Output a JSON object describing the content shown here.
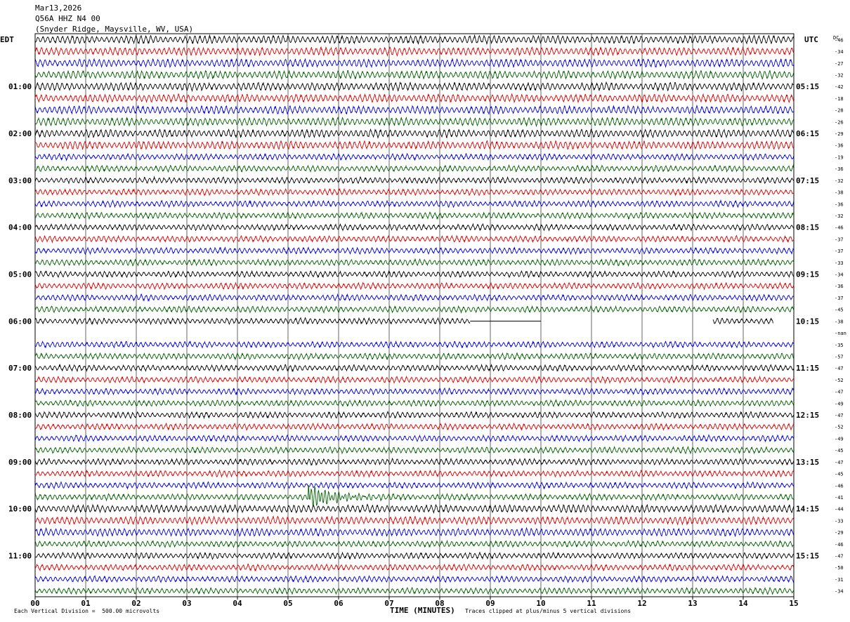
{
  "header": {
    "date": "Mar13,2026",
    "station": "Q56A HHZ N4 00",
    "location": "(Snyder Ridge, Maysville, WV, USA)"
  },
  "left_tz": "EDT",
  "right_tz": "UTC",
  "dc_header": "DC",
  "footer": {
    "scale_note": "Each Vertical Division =  500.00 microvolts",
    "xlabel": "TIME (MINUTES)",
    "clip_note": "Traces clipped at plus/minus 5 vertical divisions"
  },
  "colors": {
    "trace_cycle": [
      "#000000",
      "#e00000",
      "#0000e0",
      "#006000"
    ],
    "grid": "#000000"
  },
  "chart_data": {
    "type": "line",
    "subtype": "helicorder",
    "x_ticks": [
      "00",
      "01",
      "02",
      "03",
      "04",
      "05",
      "06",
      "07",
      "08",
      "09",
      "10",
      "11",
      "12",
      "13",
      "14",
      "15"
    ],
    "xlim": [
      0,
      15
    ],
    "left_time_labels": [
      "01:00",
      "02:00",
      "03:00",
      "04:00",
      "05:00",
      "06:00",
      "07:00",
      "08:00",
      "09:00",
      "10:00",
      "11:00"
    ],
    "right_time_labels": [
      "05:15",
      "06:15",
      "07:15",
      "08:15",
      "09:15",
      "10:15",
      "11:15",
      "12:15",
      "13:15",
      "14:15",
      "15:15"
    ],
    "dc_offsets": [
      "-46",
      "-34",
      "-27",
      "-32",
      "-42",
      "-18",
      "-28",
      "-26",
      "-29",
      "-36",
      "-19",
      "-36",
      "-32",
      "-38",
      "-36",
      "-32",
      "-46",
      "-37",
      "-37",
      "-33",
      "-34",
      "-36",
      "-37",
      "-45",
      "-38",
      "-nan",
      "-35",
      "-57",
      "-47",
      "-52",
      "-47",
      "-49",
      "-47",
      "-52",
      "-49",
      "-45",
      "-47",
      "-45",
      "-46",
      "-41",
      "-44",
      "-33",
      "-29",
      "-46",
      "-47",
      "-50",
      "-31",
      "-34"
    ],
    "rows": 48,
    "gap_row": 24,
    "empty_row": 25,
    "event": {
      "row": 39,
      "minute": 5.4
    }
  }
}
